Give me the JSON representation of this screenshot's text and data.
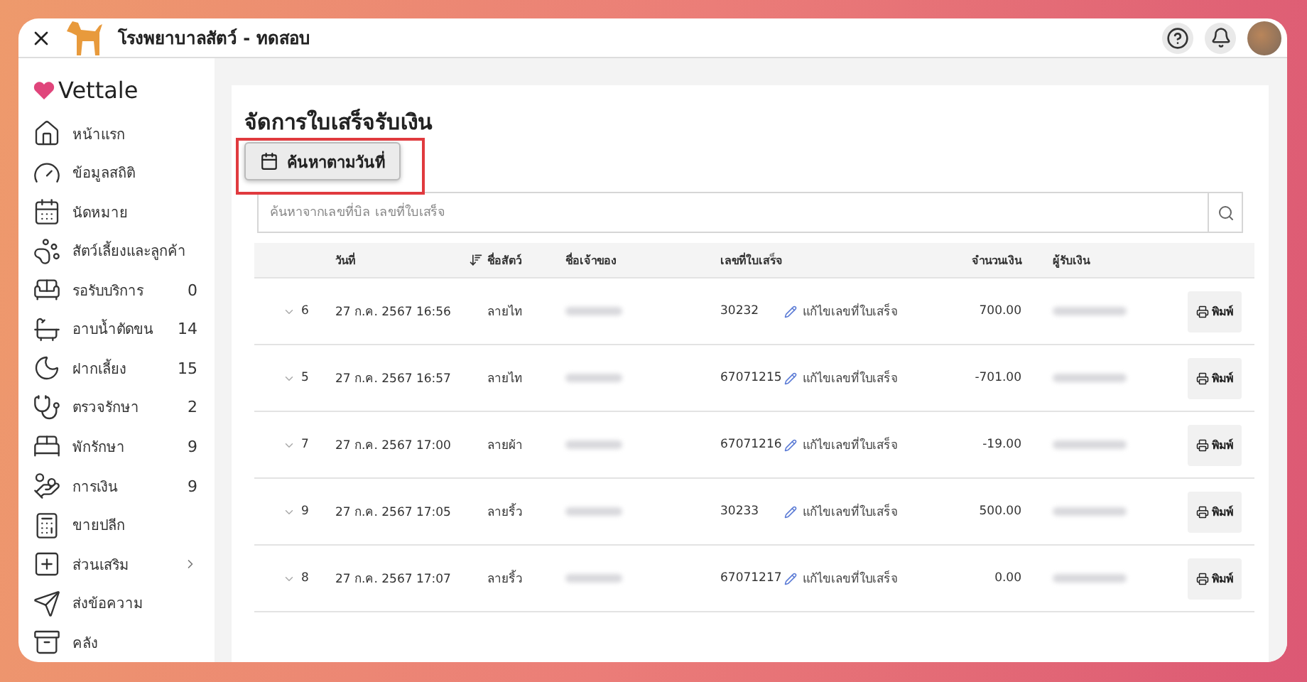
{
  "window": {
    "title": "โรงพยาบาลสัตว์ - ทดสอบ"
  },
  "brand": "Vettale",
  "sidebar": {
    "items": [
      {
        "label": "หน้าแรก",
        "expandable": false
      },
      {
        "label": "ข้อมูลสถิติ",
        "expandable": false
      },
      {
        "label": "นัดหมาย",
        "expandable": false
      },
      {
        "label": "สัตว์เลี้ยงและลูกค้า",
        "expandable": false
      },
      {
        "label": "รอรับบริการ",
        "count": "0",
        "expandable": false
      },
      {
        "label": "อาบน้ำตัดขน",
        "count": "14",
        "expandable": false
      },
      {
        "label": "ฝากเลี้ยง",
        "count": "15",
        "expandable": false
      },
      {
        "label": "ตรวจรักษา",
        "count": "2",
        "expandable": false
      },
      {
        "label": "พักรักษา",
        "count": "9",
        "expandable": false
      },
      {
        "label": "การเงิน",
        "count": "9",
        "expandable": false
      },
      {
        "label": "ขายปลีก",
        "expandable": false
      },
      {
        "label": "ส่วนเสริม",
        "expandable": true
      },
      {
        "label": "ส่งข้อความ",
        "expandable": false
      },
      {
        "label": "คลัง",
        "expandable": false
      }
    ]
  },
  "page": {
    "title": "จัดการใบเสร็จรับเงิน",
    "date_search_button": "ค้นหาตามวันที่"
  },
  "search": {
    "placeholder": "ค้นหาจากเลขที่บิล เลขที่ใบเสร็จ"
  },
  "table": {
    "columns": [
      {
        "label": "วันที่",
        "sorted": false
      },
      {
        "label": "ชื่อสัตว์",
        "sorted": true
      },
      {
        "label": "ชื่อเจ้าของ",
        "sorted": false
      },
      {
        "label": "เลขที่ใบเสร็จ",
        "sorted": false
      },
      {
        "label": "จำนวนเงิน",
        "sorted": false
      },
      {
        "label": "ผู้รับเงิน",
        "sorted": false
      }
    ],
    "rows": [
      {
        "number": "6",
        "date": "27 ก.ค. 2567 16:56",
        "pet": "ลายไท",
        "receipt": "30232",
        "edit": "แก้ไขเลขที่ใบเสร็จ",
        "amount": "700.00",
        "print": "พิมพ์"
      },
      {
        "number": "5",
        "date": "27 ก.ค. 2567 16:57",
        "pet": "ลายไท",
        "receipt": "67071215",
        "edit": "แก้ไขเลขที่ใบเสร็จ",
        "amount": "-701.00",
        "print": "พิมพ์"
      },
      {
        "number": "7",
        "date": "27 ก.ค. 2567 17:00",
        "pet": "ลายผ้า",
        "receipt": "67071216",
        "edit": "แก้ไขเลขที่ใบเสร็จ",
        "amount": "-19.00",
        "print": "พิมพ์"
      },
      {
        "number": "9",
        "date": "27 ก.ค. 2567 17:05",
        "pet": "ลายริ้ว",
        "receipt": "30233",
        "edit": "แก้ไขเลขที่ใบเสร็จ",
        "amount": "500.00",
        "print": "พิมพ์"
      },
      {
        "number": "8",
        "date": "27 ก.ค. 2567 17:07",
        "pet": "ลายริ้ว",
        "receipt": "67071217",
        "edit": "แก้ไขเลขที่ใบเสร็จ",
        "amount": "0.00",
        "print": "พิมพ์"
      }
    ]
  }
}
